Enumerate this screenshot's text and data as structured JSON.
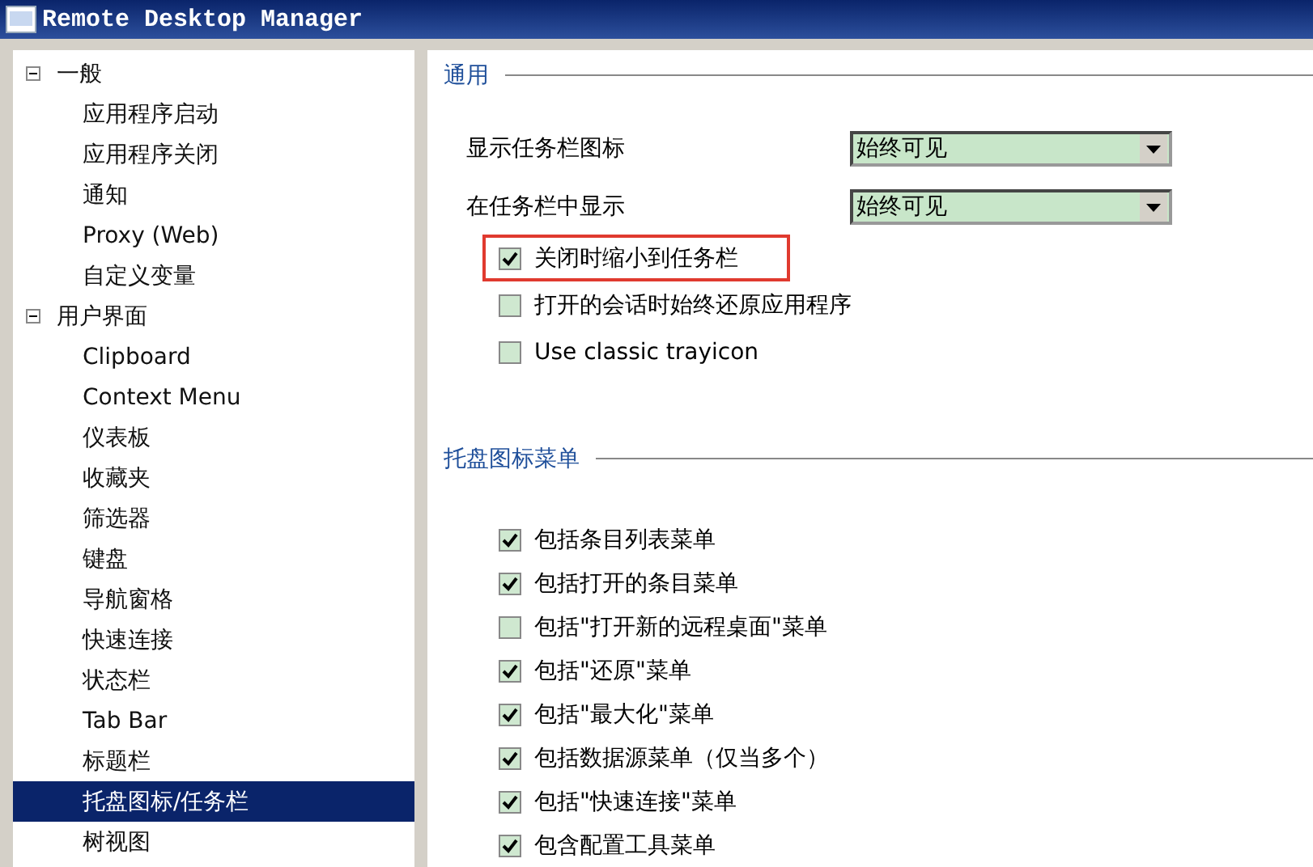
{
  "window": {
    "title": "Remote Desktop Manager"
  },
  "sidebar": {
    "items": [
      {
        "label": "一般",
        "expanded": true,
        "selected": false,
        "children": [
          {
            "label": "应用程序启动",
            "selected": false
          },
          {
            "label": "应用程序关闭",
            "selected": false
          },
          {
            "label": "通知",
            "selected": false
          },
          {
            "label": "Proxy (Web)",
            "selected": false
          },
          {
            "label": "自定义变量",
            "selected": false
          }
        ]
      },
      {
        "label": "用户界面",
        "expanded": true,
        "selected": false,
        "children": [
          {
            "label": "Clipboard",
            "selected": false
          },
          {
            "label": "Context Menu",
            "selected": false
          },
          {
            "label": "仪表板",
            "selected": false
          },
          {
            "label": "收藏夹",
            "selected": false
          },
          {
            "label": "筛选器",
            "selected": false
          },
          {
            "label": "键盘",
            "selected": false
          },
          {
            "label": "导航窗格",
            "selected": false
          },
          {
            "label": "快速连接",
            "selected": false
          },
          {
            "label": "状态栏",
            "selected": false
          },
          {
            "label": "Tab Bar",
            "selected": false
          },
          {
            "label": "标题栏",
            "selected": false
          },
          {
            "label": "托盘图标/任务栏",
            "selected": true
          },
          {
            "label": "树视图",
            "selected": false
          }
        ]
      }
    ]
  },
  "sections": [
    {
      "title": "通用",
      "fields": [
        {
          "label": "显示任务栏图标",
          "value": "始终可见"
        },
        {
          "label": "在任务栏中显示",
          "value": "始终可见"
        }
      ],
      "checkboxes": [
        {
          "label": "关闭时缩小到任务栏",
          "checked": true,
          "highlighted": true
        },
        {
          "label": "打开的会话时始终还原应用程序",
          "checked": false,
          "highlighted": false
        },
        {
          "label": "Use classic trayicon",
          "checked": false,
          "highlighted": false
        }
      ]
    },
    {
      "title": "托盘图标菜单",
      "checkboxes": [
        {
          "label": "包括条目列表菜单",
          "checked": true,
          "highlighted": false
        },
        {
          "label": "包括打开的条目菜单",
          "checked": true,
          "highlighted": false
        },
        {
          "label": "包括\"打开新的远程桌面\"菜单",
          "checked": false,
          "highlighted": false
        },
        {
          "label": "包括\"还原\"菜单",
          "checked": true,
          "highlighted": false
        },
        {
          "label": "包括\"最大化\"菜单",
          "checked": true,
          "highlighted": false
        },
        {
          "label": "包括数据源菜单（仅当多个）",
          "checked": true,
          "highlighted": false
        },
        {
          "label": "包括\"快速连接\"菜单",
          "checked": true,
          "highlighted": false
        },
        {
          "label": "包含配置工具菜单",
          "checked": true,
          "highlighted": false
        }
      ]
    }
  ]
}
